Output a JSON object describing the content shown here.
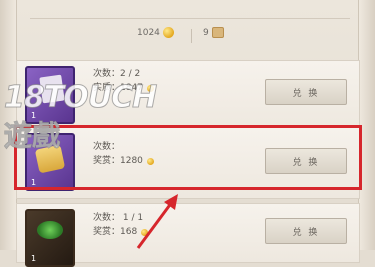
{
  "currency": {
    "coins_value": "1024",
    "tickets_value": "9"
  },
  "items": [
    {
      "count_label": "次数：2 / 2",
      "price_label": "实质：1847",
      "badge": "1",
      "button_label": "兑 换"
    },
    {
      "count_label": "次数：",
      "price_label": "奖赏：1280",
      "badge": "1",
      "button_label": "兑 换"
    },
    {
      "count_label": "次数： 1 / 1",
      "price_label": "奖赏：168",
      "badge": "1",
      "button_label": "兑 换"
    }
  ],
  "watermark": {
    "line1": "18TOUCH",
    "line2": "遊戲"
  },
  "colors": {
    "highlight": "#d6262c",
    "purple_tile": "#7a52b4",
    "green_tile": "#2c7a26"
  }
}
